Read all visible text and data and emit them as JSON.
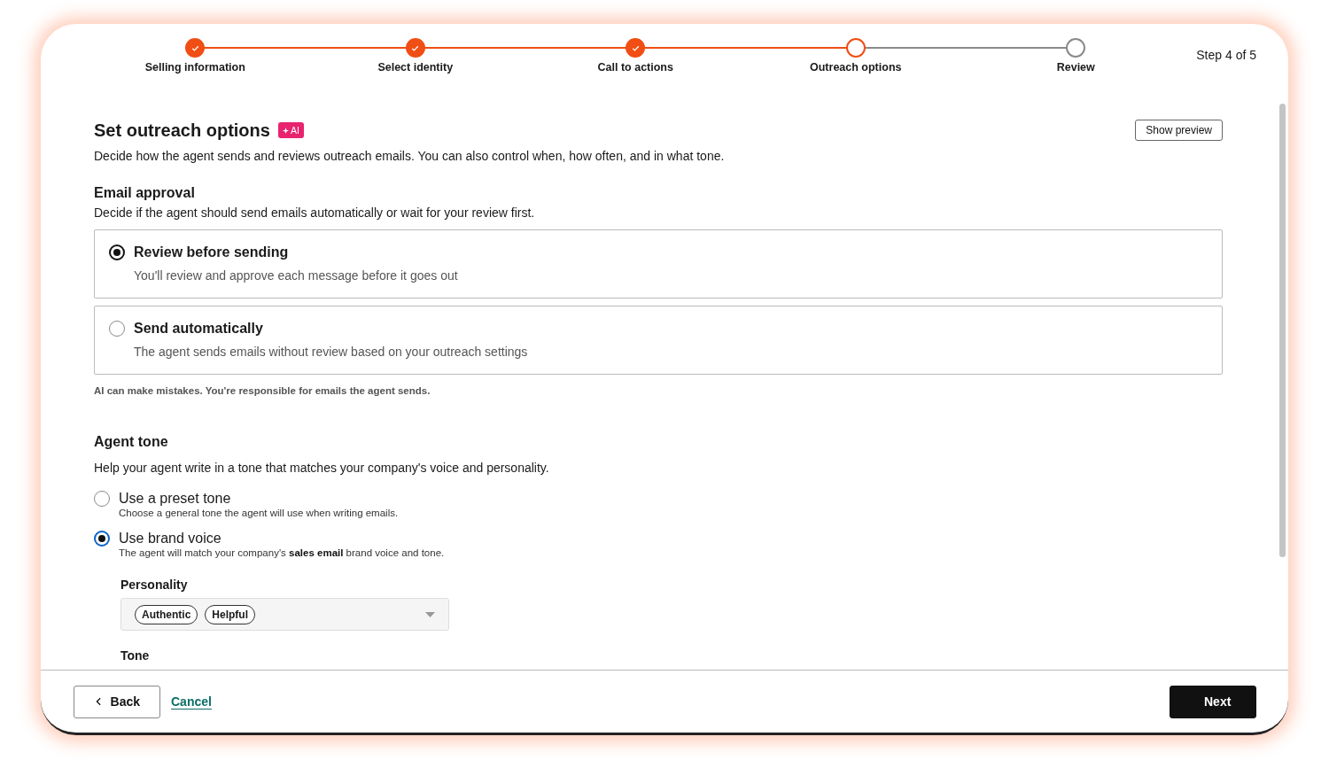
{
  "steps": [
    {
      "label": "Selling information",
      "completed": true
    },
    {
      "label": "Select identity",
      "completed": true
    },
    {
      "label": "Call to actions",
      "completed": true
    },
    {
      "label": "Outreach options",
      "completed": false
    },
    {
      "label": "Review",
      "completed": false
    }
  ],
  "step_counter": "Step 4 of 5",
  "title": "Set outreach options",
  "badge": "AI",
  "show_preview": "Show preview",
  "description": "Decide how the agent sends and reviews outreach emails. You can also control when, how often, and in what tone.",
  "email_approval": {
    "heading": "Email approval",
    "description": "Decide if the agent should send emails automatically or wait for your review first.",
    "options": [
      {
        "label": "Review before sending",
        "description": "You'll review and approve each message before it goes out",
        "selected": true
      },
      {
        "label": "Send automatically",
        "description": "The agent sends emails without review based on your outreach settings",
        "selected": false
      }
    ],
    "note": "AI can make mistakes. You're responsible for emails the agent sends."
  },
  "agent_tone": {
    "heading": "Agent tone",
    "description": "Help your agent write in a tone that matches your company's voice and personality.",
    "options": [
      {
        "label": "Use a preset tone",
        "description": "Choose a general tone the agent will use when writing emails.",
        "selected": false
      },
      {
        "label": "Use brand voice",
        "description": "The agent will match your company's **sales email** brand voice and tone.",
        "selected": true
      }
    ],
    "personality": {
      "label": "Personality",
      "chips": [
        "Authentic",
        "Helpful"
      ]
    },
    "tone_label": "Tone"
  },
  "footer": {
    "back": "Back",
    "cancel": "Cancel",
    "next": "Next"
  }
}
